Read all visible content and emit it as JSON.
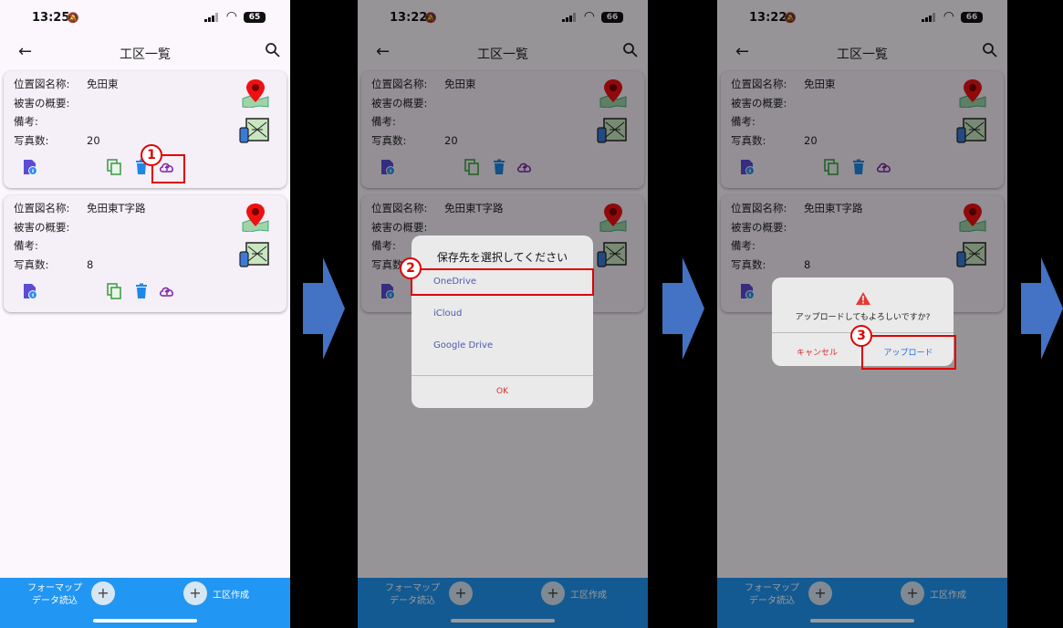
{
  "status": {
    "time_1": "13:25",
    "time_2": "13:22",
    "time_3": "13:22",
    "battery_1": "65",
    "battery_2": "66",
    "battery_3": "66"
  },
  "appbar": {
    "title": "工区一覧"
  },
  "labels": {
    "location": "位置図名称:",
    "damage": "被害の概要:",
    "note": "備考:",
    "photos": "写真数:"
  },
  "cards": [
    {
      "location": "免田東",
      "damage": "",
      "note": "",
      "photos": "20"
    },
    {
      "location": "免田東T字路",
      "damage": "",
      "note": "",
      "photos": "8"
    }
  ],
  "bottom": {
    "format_line1": "フォーマップ",
    "format_line2": "データ読込",
    "plus": "+",
    "new_site": "工区作成"
  },
  "save_dialog": {
    "title": "保存先を選択してください",
    "options": [
      "OneDrive",
      "iCloud",
      "Google Drive"
    ],
    "ok": "OK"
  },
  "confirm_dialog": {
    "message": "アップロードしてもよろしいですか?",
    "cancel": "キャンセル",
    "upload": "アップロード"
  },
  "steps": [
    "1",
    "2",
    "3"
  ],
  "colors": {
    "bottombar": "#2196f3",
    "highlight": "#e00000",
    "arrow": "#4472c4",
    "card": "#f5eff8"
  }
}
